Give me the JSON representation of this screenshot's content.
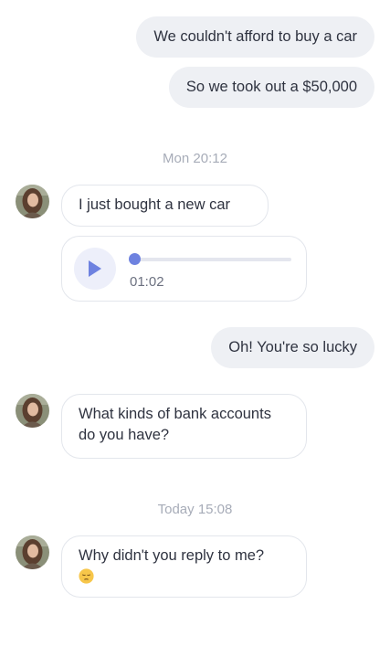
{
  "conversation": {
    "messages": [
      {
        "direction": "outgoing",
        "text": "We couldn't afford to buy a car"
      },
      {
        "direction": "outgoing",
        "text": "So we took out a $50,000"
      },
      {
        "type": "timestamp",
        "text": "Mon 20:12"
      },
      {
        "direction": "incoming",
        "text": "I just bought a new car",
        "icon": "contact-avatar"
      },
      {
        "direction": "incoming",
        "type": "voice",
        "icon": "play-icon",
        "duration": "01:02",
        "progress": 0.0
      },
      {
        "direction": "outgoing",
        "text": "Oh! You're so lucky"
      },
      {
        "direction": "incoming",
        "text_line1": "What kinds of bank accounts",
        "text_line2": "do you have?",
        "icon": "contact-avatar"
      },
      {
        "type": "timestamp",
        "text": "Today 15:08"
      },
      {
        "direction": "incoming",
        "text": "Why didn't you reply to me?",
        "emoji": "pensive-face-emoji",
        "icon": "contact-avatar"
      }
    ]
  },
  "colors": {
    "outgoing_bubble": "#eef0f4",
    "incoming_border": "#e3e6ec",
    "accent": "#6e82e0",
    "timestamp": "#a7acb8"
  }
}
